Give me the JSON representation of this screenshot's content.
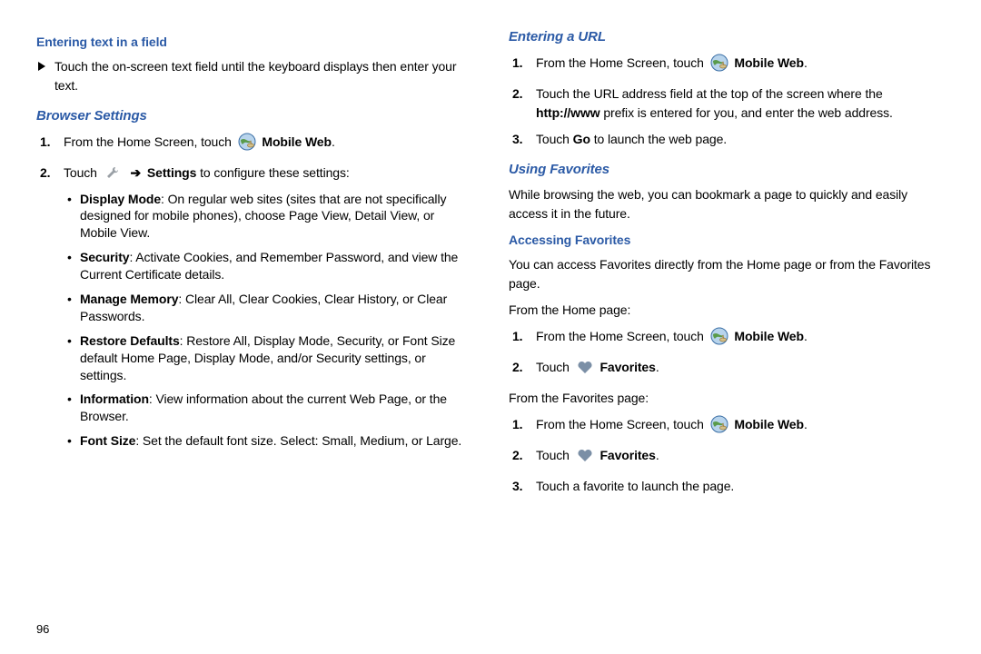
{
  "page_number": "96",
  "icons": {
    "mobile_web": "mobile-web-globe-icon",
    "wrench": "wrench-icon",
    "heart": "heart-icon"
  },
  "left": {
    "h1": "Entering text in a field",
    "bullet1": "Touch the on-screen text field until the keyboard displays then enter your text.",
    "h2": "Browser Settings",
    "step1_a": "From the Home Screen, touch",
    "step1_b": "Mobile Web",
    "step1_c": ".",
    "step2_a": "Touch",
    "step2_arrow": "➔",
    "step2_b": "Settings",
    "step2_c": " to configure these settings:",
    "sub": [
      {
        "b": "Display Mode",
        "t": ": On regular web sites (sites that are not specifically designed for mobile phones), choose Page View, Detail View, or Mobile View."
      },
      {
        "b": "Security",
        "t": ": Activate Cookies, and Remember Password, and view the Current Certificate details."
      },
      {
        "b": "Manage Memory",
        "t": ": Clear All, Clear Cookies, Clear History, or Clear Passwords."
      },
      {
        "b": "Restore Defaults",
        "t": ": Restore All, Display Mode, Security, or Font Size default Home Page, Display Mode, and/or Security settings, or settings."
      },
      {
        "b": "Information",
        "t": ": View information about the current Web Page, or the Browser."
      },
      {
        "b": "Font Size",
        "t": ": Set the default font size. Select: Small, Medium, or Large."
      }
    ]
  },
  "right": {
    "h1": "Entering a URL",
    "steps_a": [
      {
        "pre": "From the Home Screen, touch",
        "bold": "Mobile Web",
        "post": ".",
        "icon": "mw"
      },
      {
        "text_parts": [
          "Touch the URL address field at the top of the screen where the ",
          "http://www",
          " prefix is entered for you, and enter the web address."
        ]
      },
      {
        "text_parts": [
          "Touch ",
          "Go",
          " to launch the web page."
        ]
      }
    ],
    "h2": "Using Favorites",
    "p1": "While browsing the web, you can bookmark a page to quickly and easily access it in the future.",
    "h3": "Accessing Favorites",
    "p2": "You can access Favorites directly from the Home page or from the Favorites page.",
    "from_home_label": "From the Home page:",
    "home_steps": [
      {
        "pre": "From the Home Screen, touch",
        "bold": "Mobile Web",
        "post": ".",
        "icon": "mw"
      },
      {
        "pre": "Touch",
        "bold": "Favorites",
        "post": ".",
        "icon": "heart"
      }
    ],
    "from_fav_label": "From the Favorites page:",
    "fav_steps": [
      {
        "pre": "From the Home Screen, touch",
        "bold": "Mobile Web",
        "post": ".",
        "icon": "mw"
      },
      {
        "pre": "Touch",
        "bold": "Favorites",
        "post": ".",
        "icon": "heart"
      },
      {
        "plain": "Touch a favorite to launch the page."
      }
    ]
  }
}
